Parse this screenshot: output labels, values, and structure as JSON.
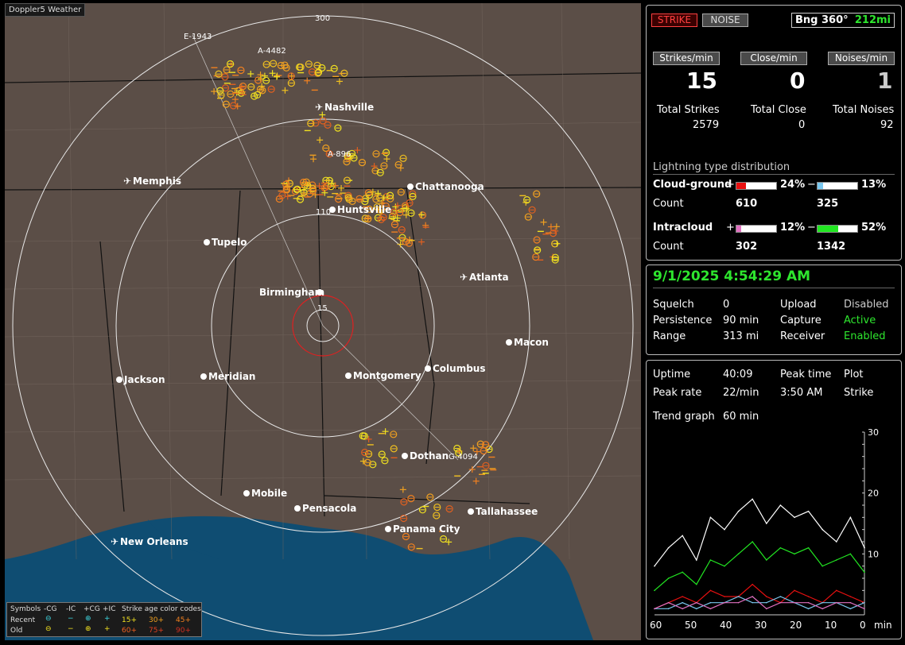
{
  "app": {
    "title": "Doppler5 Weather"
  },
  "map": {
    "cities": [
      {
        "name": "Nashville",
        "icon": "airport-icon"
      },
      {
        "name": "Memphis",
        "icon": "airport-icon"
      },
      {
        "name": "Chattanooga",
        "icon": "city-dot"
      },
      {
        "name": "Huntsville",
        "icon": "city-dot"
      },
      {
        "name": "Tupelo",
        "icon": "city-dot"
      },
      {
        "name": "Atlanta",
        "icon": "airport-icon"
      },
      {
        "name": "Birmingham",
        "icon": "city-dot"
      },
      {
        "name": "Macon",
        "icon": "city-dot"
      },
      {
        "name": "Jackson",
        "icon": "city-dot"
      },
      {
        "name": "Meridian",
        "icon": "city-dot"
      },
      {
        "name": "Montgomery",
        "icon": "city-dot"
      },
      {
        "name": "Columbus",
        "icon": "city-dot"
      },
      {
        "name": "Dothan",
        "icon": "city-dot"
      },
      {
        "name": "Mobile",
        "icon": "city-dot"
      },
      {
        "name": "Pensacola",
        "icon": "city-dot"
      },
      {
        "name": "Tallahassee",
        "icon": "city-dot"
      },
      {
        "name": "Panama City",
        "icon": "city-dot"
      },
      {
        "name": "New Orleans",
        "icon": "airport-icon"
      }
    ],
    "ring_labels": [
      "300",
      "110",
      "15"
    ],
    "storm_ids": [
      "E-1943",
      "A-4482",
      "A-896",
      "G-4094"
    ],
    "legend": {
      "symbols_label": "Symbols",
      "headers": [
        "-CG",
        "-IC",
        "+CG",
        "+IC"
      ],
      "age_label": "Strike age color codes",
      "recent_label": "Recent",
      "old_label": "Old",
      "recent_ages": [
        "15+",
        "30+",
        "45+"
      ],
      "old_ages": [
        "60+",
        "75+",
        "90+"
      ]
    }
  },
  "panel1": {
    "strike_btn": "STRIKE",
    "noise_btn": "NOISE",
    "bearing": "Bng 360°",
    "range_readout": "212mi",
    "rate_headers": [
      "Strikes/min",
      "Close/min",
      "Noises/min"
    ],
    "rate_values": [
      "15",
      "0",
      "1"
    ],
    "total_labels": [
      "Total Strikes",
      "Total Close",
      "Total Noises"
    ],
    "total_values": [
      "2579",
      "0",
      "92"
    ],
    "dist_title": "Lightning type distribution",
    "cg_label": "Cloud-ground",
    "ic_label": "Intracloud",
    "plus": "+",
    "minus": "−",
    "count_label": "Count",
    "cg_pos_pct": "24%",
    "cg_neg_pct": "13%",
    "cg_pos_count": "610",
    "cg_neg_count": "325",
    "ic_pos_pct": "12%",
    "ic_neg_pct": "52%",
    "ic_pos_count": "302",
    "ic_neg_count": "1342",
    "fractions": {
      "cg_pos": 0.24,
      "cg_neg": 0.13,
      "ic_pos": 0.12,
      "ic_neg": 0.52
    },
    "colors": {
      "cg_pos": "#e81010",
      "cg_neg": "#7ac8f0",
      "ic_pos": "#e070c0",
      "ic_neg": "#22e622"
    }
  },
  "panel2": {
    "datetime": "9/1/2025 4:54:29 AM",
    "rows": [
      {
        "label": "Squelch",
        "value": "0",
        "label2": "Upload",
        "value2": "Disabled"
      },
      {
        "label": "Persistence",
        "value": "90 min",
        "label2": "Capture",
        "value2": "Active"
      },
      {
        "label": "Range",
        "value": "313 mi",
        "label2": "Receiver",
        "value2": "Enabled"
      }
    ]
  },
  "panel3": {
    "uptime_label": "Uptime",
    "uptime": "40:09",
    "peak_time_label": "Peak time",
    "plot_label": "Plot",
    "peak_rate_label": "Peak rate",
    "peak_rate": "22/min",
    "peak_time": "3:50 AM",
    "plot_value": "Strike",
    "trend_label": "Trend graph",
    "trend_value": "60 min",
    "x_ticks": [
      "60",
      "50",
      "40",
      "30",
      "20",
      "10",
      "0"
    ],
    "x_unit": "min",
    "y_ticks": [
      "30",
      "20",
      "10"
    ]
  },
  "chart_data": {
    "type": "line",
    "x": [
      60,
      56,
      52,
      48,
      44,
      40,
      36,
      32,
      28,
      24,
      20,
      16,
      12,
      8,
      4,
      0
    ],
    "ylim": [
      0,
      30
    ],
    "xlim": [
      60,
      0
    ],
    "series": [
      {
        "color": "#ffffff",
        "values": [
          8,
          11,
          13,
          9,
          16,
          14,
          17,
          19,
          15,
          18,
          16,
          17,
          14,
          12,
          16,
          11
        ]
      },
      {
        "color": "#22e622",
        "values": [
          4,
          6,
          7,
          5,
          9,
          8,
          10,
          12,
          9,
          11,
          10,
          11,
          8,
          9,
          10,
          7
        ]
      },
      {
        "color": "#e81010",
        "values": [
          1,
          2,
          3,
          2,
          4,
          3,
          3,
          5,
          3,
          2,
          4,
          3,
          2,
          4,
          3,
          2
        ]
      },
      {
        "color": "#7ac8f0",
        "values": [
          1,
          1,
          2,
          1,
          2,
          2,
          3,
          2,
          2,
          3,
          2,
          1,
          2,
          2,
          1,
          2
        ]
      },
      {
        "color": "#e070c0",
        "values": [
          1,
          2,
          1,
          2,
          1,
          2,
          2,
          3,
          1,
          2,
          2,
          2,
          1,
          2,
          2,
          1
        ]
      }
    ]
  }
}
